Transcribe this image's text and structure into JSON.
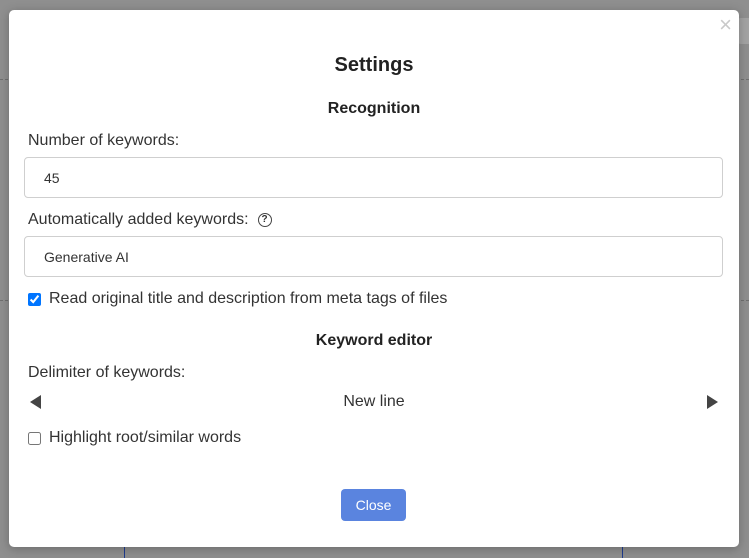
{
  "modal": {
    "close_glyph": "×",
    "title": "Settings",
    "recognition": {
      "heading": "Recognition",
      "num_keywords_label": "Number of keywords:",
      "num_keywords_value": "45",
      "auto_keywords_label": "Automatically added keywords:",
      "help_glyph": "?",
      "auto_keywords_value": "Generative AI",
      "read_meta_label": "Read original title and description from meta tags of files",
      "read_meta_checked": true
    },
    "keyword_editor": {
      "heading": "Keyword editor",
      "delimiter_label": "Delimiter of keywords:",
      "delimiter_value": "New line",
      "highlight_label": "Highlight root/similar words",
      "highlight_checked": false
    },
    "close_button": "Close"
  },
  "colors": {
    "accent": "#5a84df",
    "overlay": "#8f8f8f",
    "modal_bg": "#ffffff"
  },
  "icons": {
    "close": "close-icon",
    "help": "help-circle-icon",
    "left": "triangle-left-icon",
    "right": "triangle-right-icon"
  }
}
